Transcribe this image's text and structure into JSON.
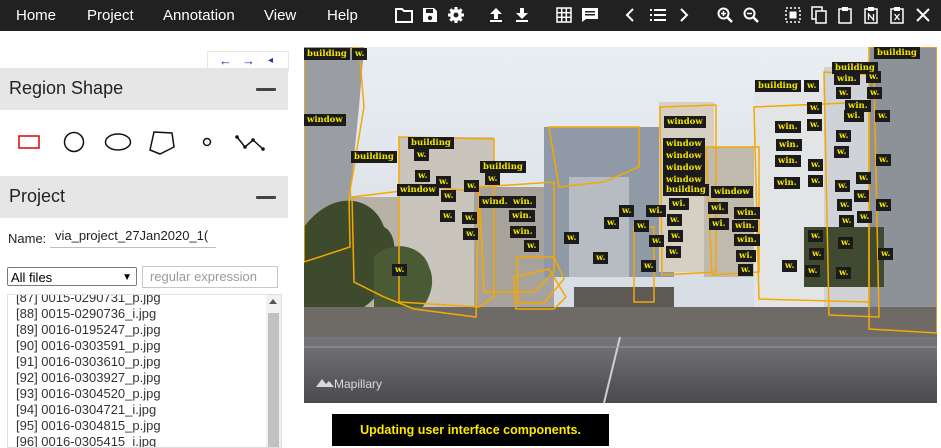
{
  "menu": [
    "Home",
    "Project",
    "Annotation",
    "View",
    "Help"
  ],
  "toolbar_icons": [
    "folder-open-icon",
    "save-icon",
    "settings-icon",
    "upload-icon",
    "download-icon",
    "grid-view-icon",
    "comment-icon",
    "prev-image-icon",
    "image-list-icon",
    "next-image-icon",
    "zoom-in-icon",
    "zoom-out-icon",
    "select-all-icon",
    "copy-icon",
    "paste-icon",
    "paste-n-icon",
    "delete-region-icon",
    "close-icon"
  ],
  "nav_arrows": {
    "left": "←",
    "right": "→",
    "small": "◂"
  },
  "region_shape": {
    "title": "Region Shape",
    "shapes": [
      "rectangle",
      "circle",
      "ellipse",
      "polygon",
      "point",
      "polyline"
    ]
  },
  "project": {
    "title": "Project",
    "name_label": "Name:",
    "name_value": "via_project_27Jan2020_1(",
    "filter_value": "All files",
    "regex_placeholder": "regular expression",
    "files": [
      "[87] 0015-0290731_p.jpg",
      "[88] 0015-0290736_i.jpg",
      "[89] 0016-0195247_p.jpg",
      "[90] 0016-0303591_p.jpg",
      "[91] 0016-0303610_p.jpg",
      "[92] 0016-0303927_p.jpg",
      "[93] 0016-0304520_p.jpg",
      "[94] 0016-0304721_i.jpg",
      "[95] 0016-0304815_p.jpg",
      "[96] 0016-0305415_i.jpg"
    ]
  },
  "image": {
    "watermark": "Mapillary",
    "labels": [
      "building",
      "w.",
      "window",
      "building",
      "w.",
      "building",
      "w.",
      "window",
      "window",
      "window",
      "window",
      "window",
      "window",
      "building",
      "w.",
      "window",
      "w.",
      "w.",
      "wind.",
      "w.",
      "win.",
      "w.",
      "w.",
      "win.",
      "building",
      "w.",
      "win.",
      "wi.",
      "wi.",
      "w.",
      "wi.",
      "w.",
      "w.",
      "w.",
      "win.",
      "win.",
      "wi.",
      "w.",
      "w.",
      "win.",
      "win.",
      "building",
      "w.",
      "win.",
      "w.",
      "building",
      "w.",
      "win.",
      "w.",
      "w.",
      "w.",
      "w.",
      "w.",
      "w.",
      "w.",
      "building",
      "w.",
      "win.",
      "win.",
      "w.",
      "w.",
      "w.",
      "w.",
      "w.",
      "w.",
      "w.",
      "w.",
      "w.",
      "w.",
      "w.",
      "w.",
      "w.",
      "w.",
      "w.",
      "w.",
      "w.",
      "w.",
      "w.",
      "w.",
      "w.",
      "win.",
      "wi.",
      "wi.",
      "w.",
      "w."
    ]
  },
  "status": "Updating user interface components."
}
